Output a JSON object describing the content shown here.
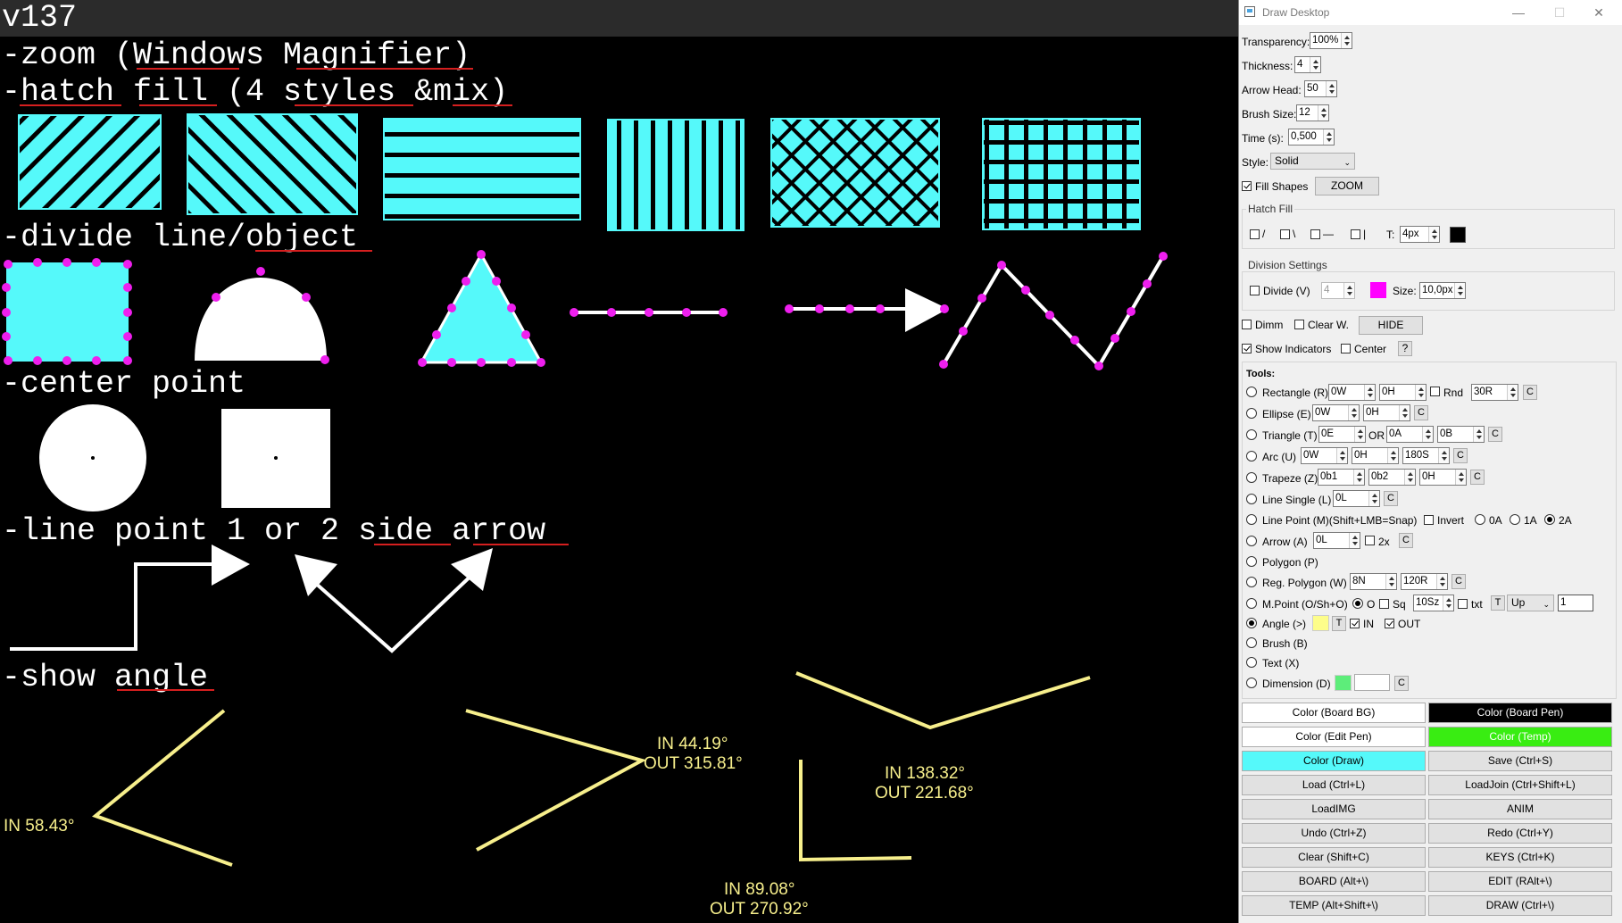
{
  "canvas": {
    "version": "v137",
    "headings": {
      "zoom": "-zoom (Windows Magnifier)",
      "hatch": "-hatch fill (4 styles &mix)",
      "divide": "-divide line/object",
      "center": "-center point",
      "arrow": "-line point 1 or 2 side arrow",
      "angle": "-show angle"
    },
    "angles": [
      {
        "in": "IN 58.43°",
        "out": ""
      },
      {
        "in": "IN 44.19°",
        "out": "OUT 315.81°"
      },
      {
        "in": "IN 138.32°",
        "out": "OUT 221.68°"
      },
      {
        "in": "IN 89.08°",
        "out": "OUT 270.92°"
      }
    ],
    "colors": {
      "fill": "#55f9fa",
      "indicator": "#ee1fee",
      "angle": "#f7ef8c",
      "spell_underline": "#d51f1f"
    }
  },
  "panel": {
    "title": "Draw Desktop",
    "window_controls": {
      "minimize": "—",
      "maximize": "☐",
      "close": "✕"
    },
    "transparency": {
      "label": "Transparency:",
      "value": "100%"
    },
    "thickness": {
      "label": "Thickness:",
      "value": "4"
    },
    "arrow_head": {
      "label": "Arrow Head:",
      "value": "50"
    },
    "brush_size": {
      "label": "Brush Size:",
      "value": "12"
    },
    "time": {
      "label": "Time (s):",
      "value": "0,500"
    },
    "style": {
      "label": "Style:",
      "value": "Solid"
    },
    "fill_shapes": {
      "label": "Fill Shapes",
      "checked": true
    },
    "zoom_button": "ZOOM",
    "hatch_fill": {
      "title": "Hatch Fill",
      "options": [
        "/",
        "\\",
        "—",
        "|"
      ],
      "t_label": "T:",
      "t_value": "4px",
      "color": "#000000"
    },
    "division": {
      "title": "Division Settings",
      "divide_label": "Divide (V)",
      "divide_value": "4",
      "color": "#ff00ff",
      "size_label": "Size:",
      "size_value": "10,0px"
    },
    "dimm": "Dimm",
    "clear_w": "Clear W.",
    "hide_button": "HIDE",
    "show_indicators": "Show Indicators",
    "center": "Center",
    "help_button": "?",
    "tools": {
      "title": "Tools:",
      "rectangle": {
        "label": "Rectangle (R)",
        "w": "0W",
        "h": "0H",
        "rnd_label": "Rnd",
        "rnd": "30R"
      },
      "ellipse": {
        "label": "Ellipse (E)",
        "w": "0W",
        "h": "0H"
      },
      "triangle": {
        "label": "Triangle (T)",
        "e": "0E",
        "or": "OR",
        "a": "0A",
        "b": "0B"
      },
      "arc": {
        "label": "Arc (U)",
        "w": "0W",
        "h": "0H",
        "s": "180S"
      },
      "trapeze": {
        "label": "Trapeze (Z)",
        "b1": "0b1",
        "b2": "0b2",
        "h": "0H"
      },
      "line_single": {
        "label": "Line Single (L)",
        "l": "0L"
      },
      "line_point": {
        "label": "Line Point (M)(Shift+LMB=Snap)",
        "invert": "Invert",
        "a0": "0A",
        "a1": "1A",
        "a2": "2A"
      },
      "arrow": {
        "label": "Arrow (A)",
        "l": "0L",
        "x2": "2x"
      },
      "polygon": {
        "label": "Polygon (P)"
      },
      "reg_polygon": {
        "label": "Reg. Polygon (W)",
        "n": "8N",
        "r": "120R"
      },
      "mpoint": {
        "label": "M.Point (O/Sh+O)",
        "o": "O",
        "sq": "Sq",
        "sz": "10Sz",
        "txt": "txt",
        "t": "T",
        "dir": "Up",
        "num": "1"
      },
      "angle": {
        "label": "Angle (>)",
        "color": "#fdfd8a",
        "t": "T",
        "in": "IN",
        "out": "OUT"
      },
      "brush": {
        "label": "Brush (B)"
      },
      "text": {
        "label": "Text (X)"
      },
      "dimension": {
        "label": "Dimension (D)",
        "color": "#5ded7a"
      },
      "c": "C"
    },
    "buttons": [
      {
        "label": "Color (Board BG)",
        "bg": "#ffffff",
        "fg": "#000000"
      },
      {
        "label": "Color (Board Pen)",
        "bg": "#000000",
        "fg": "#ffffff"
      },
      {
        "label": "Color (Edit Pen)",
        "bg": "#ffffff",
        "fg": "#000000"
      },
      {
        "label": "Color (Temp)",
        "bg": "#39ed12",
        "fg": "#ffffff"
      },
      {
        "label": "Color (Draw)",
        "bg": "#55f9fa",
        "fg": "#000000"
      },
      {
        "label": "Save (Ctrl+S)",
        "bg": "#e1e1e1",
        "fg": "#000000"
      },
      {
        "label": "Load (Ctrl+L)",
        "bg": "#e1e1e1",
        "fg": "#000000"
      },
      {
        "label": "LoadJoin (Ctrl+Shift+L)",
        "bg": "#e1e1e1",
        "fg": "#000000"
      },
      {
        "label": "LoadIMG",
        "bg": "#e1e1e1",
        "fg": "#000000"
      },
      {
        "label": "ANIM",
        "bg": "#e1e1e1",
        "fg": "#000000"
      },
      {
        "label": "Undo (Ctrl+Z)",
        "bg": "#e1e1e1",
        "fg": "#000000"
      },
      {
        "label": "Redo (Ctrl+Y)",
        "bg": "#e1e1e1",
        "fg": "#000000"
      },
      {
        "label": "Clear (Shift+C)",
        "bg": "#e1e1e1",
        "fg": "#000000"
      },
      {
        "label": "KEYS (Ctrl+K)",
        "bg": "#e1e1e1",
        "fg": "#000000"
      },
      {
        "label": "BOARD (Alt+\\)",
        "bg": "#e1e1e1",
        "fg": "#000000"
      },
      {
        "label": "EDIT (RAlt+\\)",
        "bg": "#e1e1e1",
        "fg": "#000000"
      },
      {
        "label": "TEMP (Alt+Shift+\\)",
        "bg": "#e1e1e1",
        "fg": "#000000"
      },
      {
        "label": "DRAW (Ctrl+\\)",
        "bg": "#e1e1e1",
        "fg": "#000000"
      }
    ]
  }
}
